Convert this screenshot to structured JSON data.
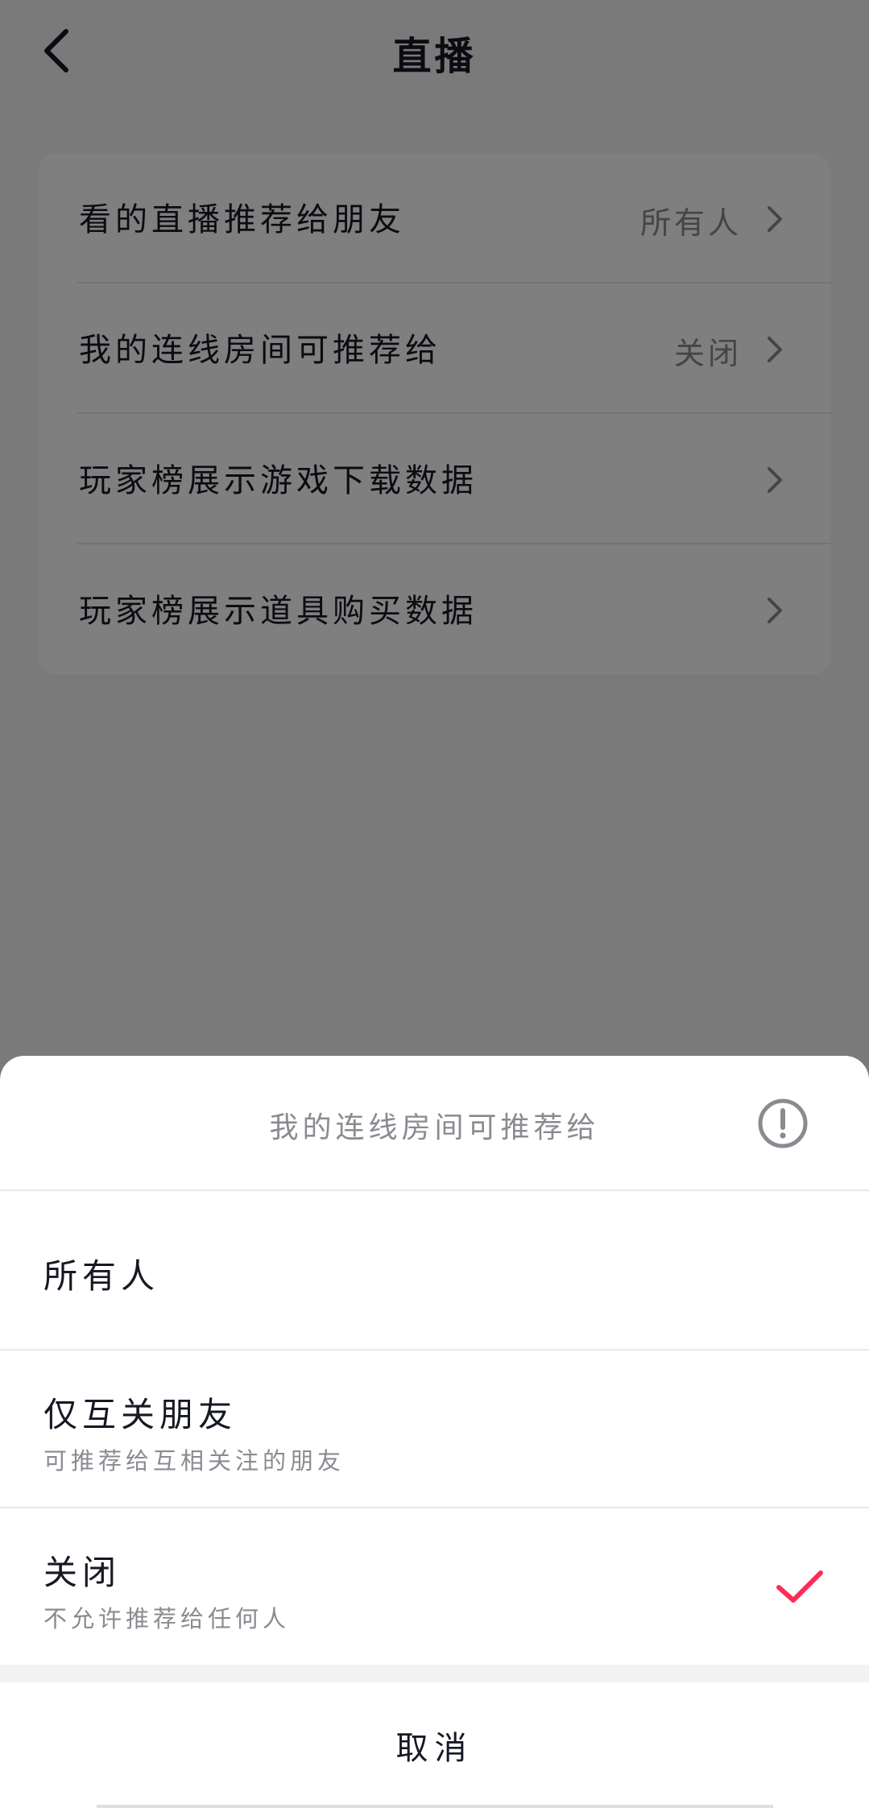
{
  "nav": {
    "title": "直播",
    "back_icon": "chevron-left-icon"
  },
  "settings": [
    {
      "label": "看的直播推荐给朋友",
      "value": "所有人"
    },
    {
      "label": "我的连线房间可推荐给",
      "value": "关闭"
    },
    {
      "label": "玩家榜展示游戏下载数据",
      "value": ""
    },
    {
      "label": "玩家榜展示道具购买数据",
      "value": ""
    }
  ],
  "sheet": {
    "title": "我的连线房间可推荐给",
    "info_icon": "exclamation-circle-icon",
    "options": [
      {
        "label": "所有人",
        "sub": "",
        "selected": false
      },
      {
        "label": "仅互关朋友",
        "sub": "可推荐给互相关注的朋友",
        "selected": false
      },
      {
        "label": "关闭",
        "sub": "不允许推荐给任何人",
        "selected": true
      }
    ],
    "cancel_label": "取消"
  },
  "colors": {
    "accent": "#fe2c55",
    "text_primary": "#161823",
    "text_secondary": "#8a8b91",
    "overlay": "rgba(0,0,0,0.5)"
  }
}
